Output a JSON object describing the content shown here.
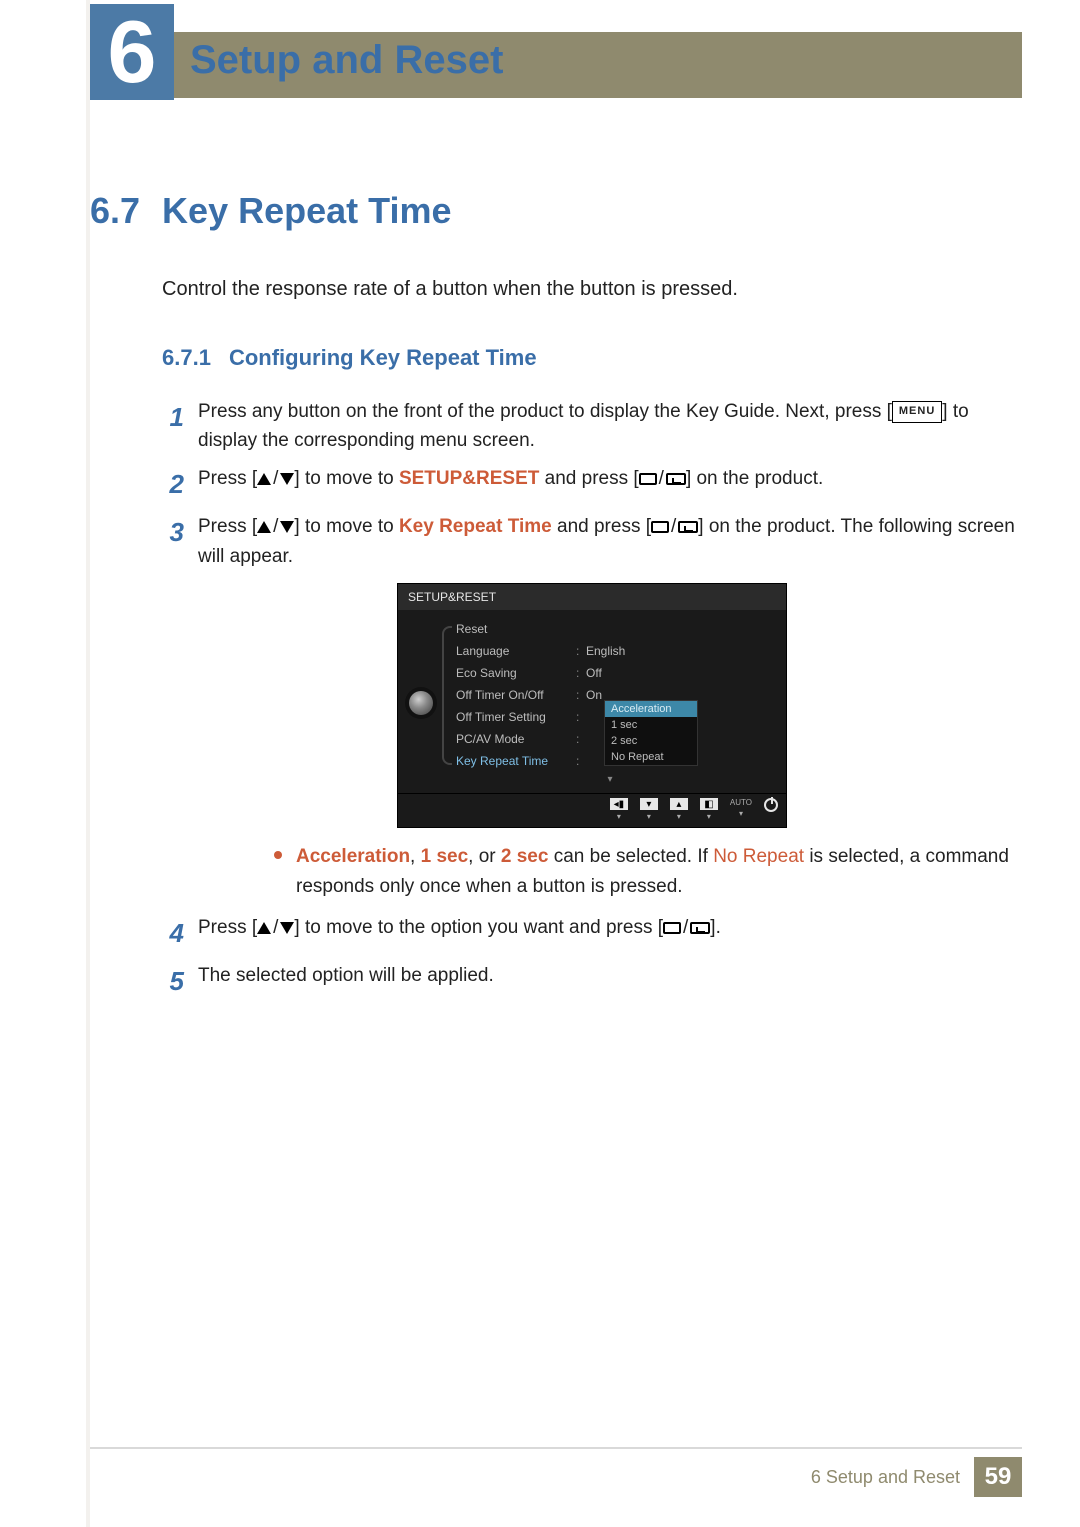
{
  "chapter": {
    "number": "6",
    "title": "Setup and Reset"
  },
  "section": {
    "number": "6.7",
    "title": "Key Repeat Time"
  },
  "intro": "Control the response rate of a button when the button is pressed.",
  "subsection": {
    "number": "6.7.1",
    "title": "Configuring Key Repeat Time"
  },
  "steps": {
    "s1": {
      "n": "1",
      "pre": "Press any button on the front of the product to display the Key Guide. Next, press [",
      "menu_chip": "MENU",
      "post": "] to display the corresponding menu screen."
    },
    "s2": {
      "n": "2",
      "a": "Press [",
      "b": "] to move to ",
      "brand": "SETUP&RESET",
      "c": " and press [",
      "d": "] on the product."
    },
    "s3": {
      "n": "3",
      "a": "Press [",
      "b": "] to move to ",
      "brand": "Key Repeat Time",
      "c": " and press [",
      "d": "] on the product. The following screen will appear."
    },
    "bullet": {
      "accel": "Acceleration",
      "comma1": ", ",
      "one": "1 sec",
      "comma2": ", or ",
      "two": "2 sec",
      "mid": " can be selected. If ",
      "norepeat": "No Repeat",
      "tail": " is selected, a command responds only once when a button is pressed."
    },
    "s4": {
      "n": "4",
      "a": "Press [",
      "b": "] to move to the option you want and press [",
      "c": "]."
    },
    "s5": {
      "n": "5",
      "text": "The selected option will be applied."
    }
  },
  "osd": {
    "title": "SETUP&RESET",
    "rows": [
      {
        "label": "Reset",
        "value": ""
      },
      {
        "label": "Language",
        "value": "English"
      },
      {
        "label": "Eco Saving",
        "value": "Off"
      },
      {
        "label": "Off Timer On/Off",
        "value": "On"
      },
      {
        "label": "Off Timer Setting",
        "value": ""
      },
      {
        "label": "PC/AV Mode",
        "value": ""
      },
      {
        "label": "Key Repeat Time",
        "value": ""
      }
    ],
    "dropdown": [
      "Acceleration",
      "1 sec",
      "2 sec",
      "No Repeat"
    ],
    "selected": "Acceleration",
    "footer_auto": "AUTO"
  },
  "footer": {
    "label": "6 Setup and Reset",
    "page": "59"
  }
}
